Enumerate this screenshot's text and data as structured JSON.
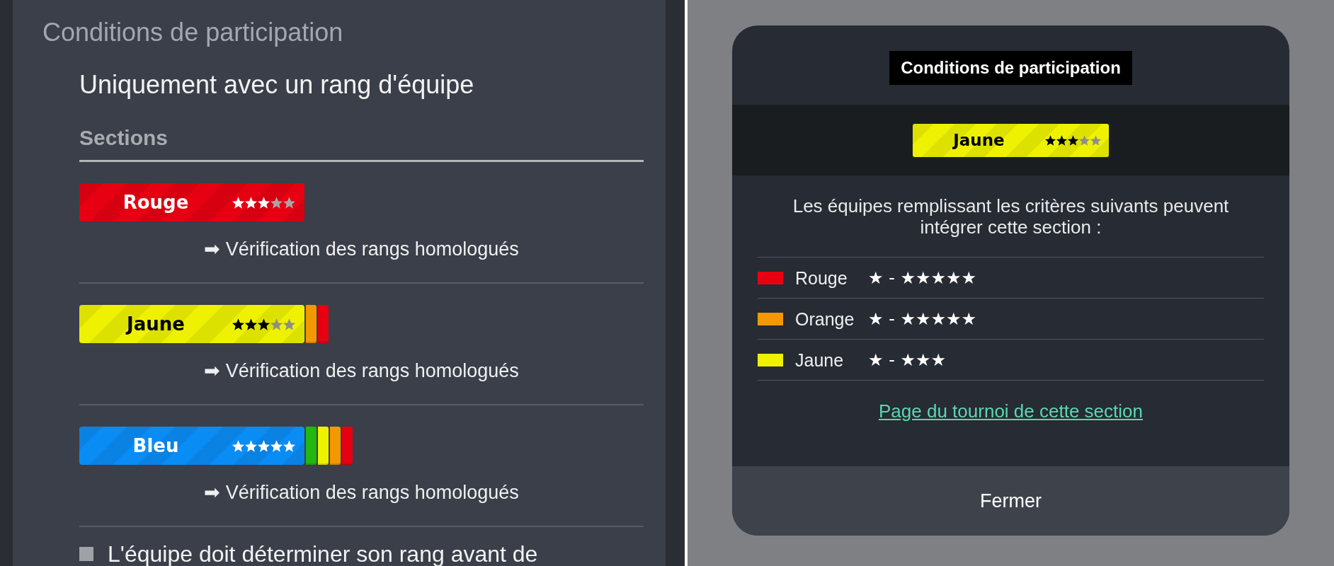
{
  "left_panel": {
    "title": "Conditions de participation",
    "requirement": "Uniquement avec un rang d'équipe",
    "sections_heading": "Sections",
    "sections": [
      {
        "label": "Rouge",
        "color": "#e60012",
        "stars": 3,
        "verification_link": "➡ Vérification des rangs homologués"
      },
      {
        "label": "Jaune",
        "color": "#eef200",
        "stars": 3,
        "lower_tabs": [
          {
            "color": "#f39800"
          },
          {
            "color": "#e60012"
          }
        ],
        "verification_link": "➡ Vérification des rangs homologués"
      },
      {
        "label": "Bleu",
        "color": "#0a8cf5",
        "stars": 5,
        "lower_tabs": [
          {
            "color": "#22b80f"
          },
          {
            "color": "#eef200"
          },
          {
            "color": "#f39800"
          },
          {
            "color": "#e60012"
          }
        ],
        "verification_link": "➡ Vérification des rangs homologués"
      }
    ],
    "note": "L'équipe doit déterminer son rang avant de"
  },
  "modal": {
    "title": "Conditions de participation",
    "badge": {
      "label": "Jaune",
      "color": "#eef200",
      "stars": 3
    },
    "description": "Les équipes remplissant les critères suivants peuvent intégrer cette section :",
    "criteria": [
      {
        "color": "#e60012",
        "name": "Rouge",
        "range": "★ - ★★★★★"
      },
      {
        "color": "#f39800",
        "name": "Orange",
        "range": "★ - ★★★★★"
      },
      {
        "color": "#eef200",
        "name": "Jaune",
        "range": "★ - ★★★"
      }
    ],
    "link": "Page du tournoi de cette section",
    "close_button": "Fermer"
  }
}
